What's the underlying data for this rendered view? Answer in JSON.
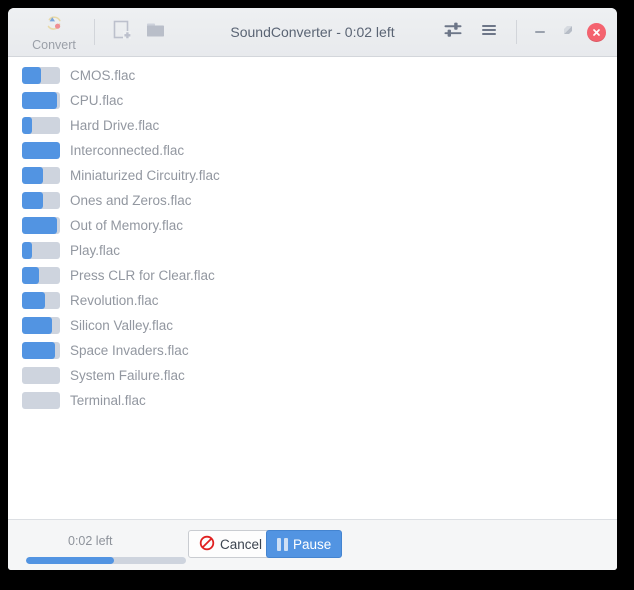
{
  "window": {
    "title": "SoundConverter - 0:02 left"
  },
  "toolbar": {
    "convert_label": "Convert",
    "convert_icon": "convert-refresh-icon",
    "add_file_icon": "add-file-icon",
    "add_folder_icon": "add-folder-icon",
    "preferences_icon": "sliders-icon",
    "menu_icon": "hamburger-menu-icon"
  },
  "window_controls": {
    "minimize_icon": "minimize-icon",
    "maximize_icon": "maximize-restore-icon",
    "close_icon": "close-icon"
  },
  "files": [
    {
      "name": "CMOS.flac",
      "progress": 50
    },
    {
      "name": "CPU.flac",
      "progress": 92
    },
    {
      "name": "Hard Drive.flac",
      "progress": 25
    },
    {
      "name": "Interconnected.flac",
      "progress": 100
    },
    {
      "name": "Miniaturized Circuitry.flac",
      "progress": 55
    },
    {
      "name": "Ones and Zeros.flac",
      "progress": 55
    },
    {
      "name": "Out of Memory.flac",
      "progress": 92
    },
    {
      "name": "Play.flac",
      "progress": 25
    },
    {
      "name": "Press CLR for Clear.flac",
      "progress": 45
    },
    {
      "name": "Revolution.flac",
      "progress": 60
    },
    {
      "name": "Silicon Valley.flac",
      "progress": 80
    },
    {
      "name": "Space Invaders.flac",
      "progress": 88
    },
    {
      "name": "System Failure.flac",
      "progress": 0
    },
    {
      "name": "Terminal.flac",
      "progress": 0
    }
  ],
  "status": {
    "eta_label": "0:02 left",
    "total_progress": 55,
    "cancel_label": "Cancel",
    "cancel_icon": "no-entry-icon",
    "pause_label": "Pause",
    "pause_icon": "pause-icon"
  },
  "colors": {
    "accent_blue": "#5294e2",
    "trough": "#ced4de",
    "close_red": "#f4636f",
    "header_bg": "#e8eaed",
    "text_muted": "#9297a0"
  }
}
